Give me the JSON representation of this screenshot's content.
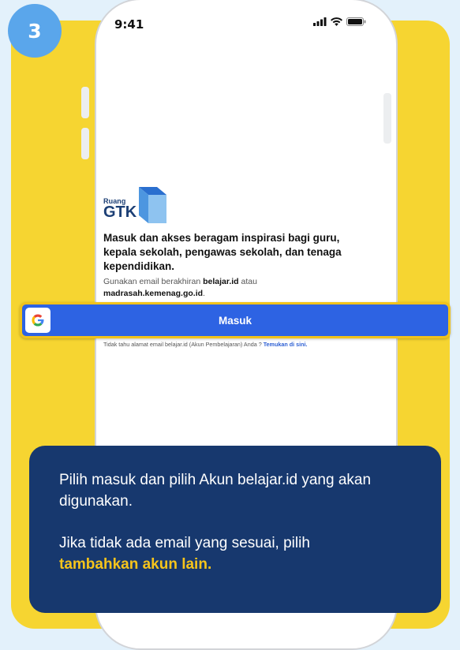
{
  "step": {
    "number": "3"
  },
  "status_bar": {
    "time": "9:41",
    "icons": [
      "signal-icon",
      "wifi-icon",
      "battery-icon"
    ]
  },
  "logo": {
    "subtitle": "Ruang",
    "title": "GTK"
  },
  "login": {
    "headline": "Masuk dan akses beragam inspirasi bagi guru, kepala sekolah, pengawas sekolah, dan tenaga kependidikan.",
    "note_prefix": "Gunakan email berakhiran",
    "note_domain1": "belajar.id",
    "note_mid": "atau",
    "note_domain2": "madrasah.kemenag.go.id",
    "note_end": ".",
    "signin_label": "Masuk",
    "help_text": "Tidak tahu alamat email belajar.id (Akun Pembelajaran) Anda ?",
    "help_link": "Temukan di sini."
  },
  "callout": {
    "line1": "Pilih masuk dan pilih Akun belajar.id yang akan digunakan.",
    "line2_prefix": "Jika tidak ada email yang sesuai, pilih",
    "line2_highlight": "tambahkan akun lain."
  },
  "colors": {
    "background": "#e3f1fb",
    "panel": "#f6d531",
    "badge": "#5aa6eb",
    "signin_button": "#2d63e3",
    "callout": "#17386e",
    "highlight": "#f6c41b"
  }
}
